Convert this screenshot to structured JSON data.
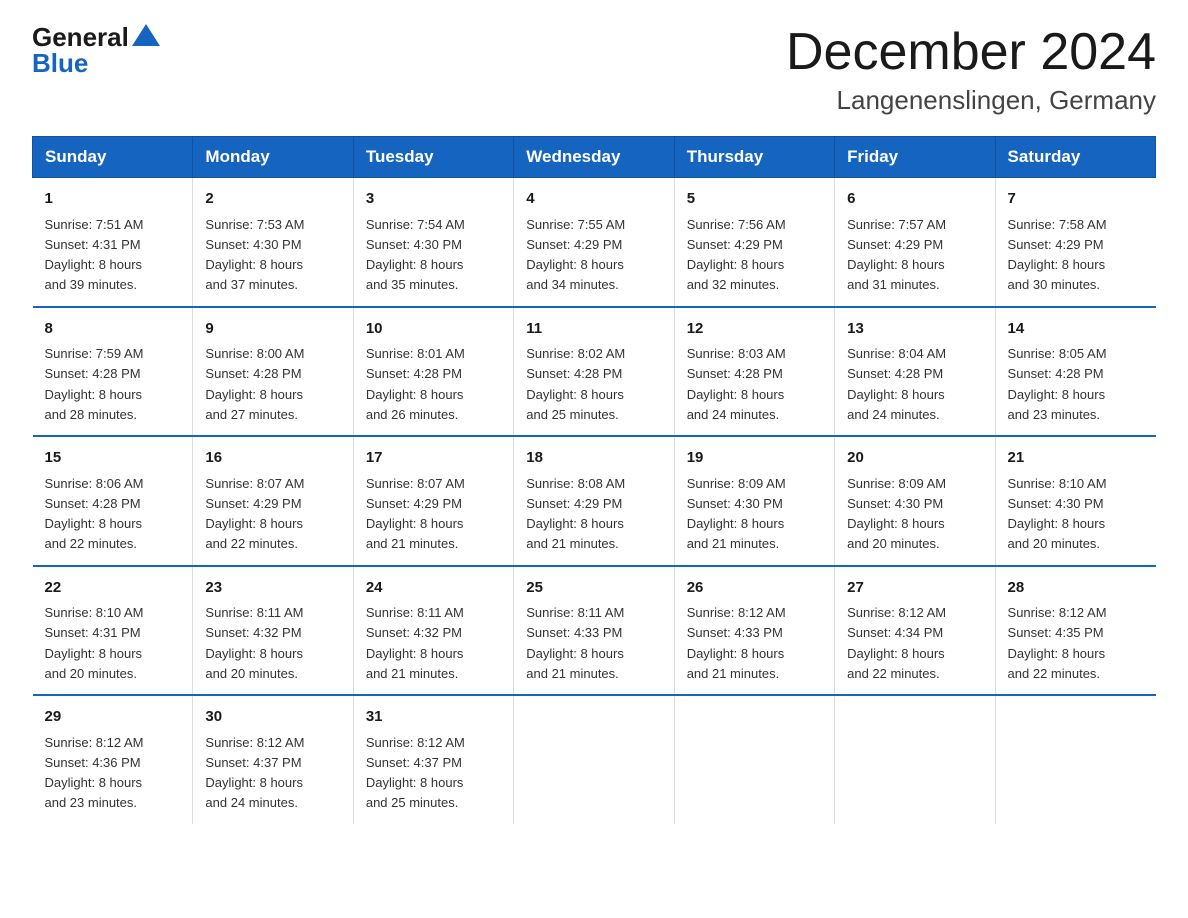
{
  "logo": {
    "text_general": "General",
    "triangle_char": "▲",
    "text_blue": "Blue"
  },
  "header": {
    "title": "December 2024",
    "subtitle": "Langenenslingen, Germany"
  },
  "days_of_week": [
    "Sunday",
    "Monday",
    "Tuesday",
    "Wednesday",
    "Thursday",
    "Friday",
    "Saturday"
  ],
  "weeks": [
    [
      {
        "day": "1",
        "sunrise": "7:51 AM",
        "sunset": "4:31 PM",
        "daylight": "8 hours and 39 minutes."
      },
      {
        "day": "2",
        "sunrise": "7:53 AM",
        "sunset": "4:30 PM",
        "daylight": "8 hours and 37 minutes."
      },
      {
        "day": "3",
        "sunrise": "7:54 AM",
        "sunset": "4:30 PM",
        "daylight": "8 hours and 35 minutes."
      },
      {
        "day": "4",
        "sunrise": "7:55 AM",
        "sunset": "4:29 PM",
        "daylight": "8 hours and 34 minutes."
      },
      {
        "day": "5",
        "sunrise": "7:56 AM",
        "sunset": "4:29 PM",
        "daylight": "8 hours and 32 minutes."
      },
      {
        "day": "6",
        "sunrise": "7:57 AM",
        "sunset": "4:29 PM",
        "daylight": "8 hours and 31 minutes."
      },
      {
        "day": "7",
        "sunrise": "7:58 AM",
        "sunset": "4:29 PM",
        "daylight": "8 hours and 30 minutes."
      }
    ],
    [
      {
        "day": "8",
        "sunrise": "7:59 AM",
        "sunset": "4:28 PM",
        "daylight": "8 hours and 28 minutes."
      },
      {
        "day": "9",
        "sunrise": "8:00 AM",
        "sunset": "4:28 PM",
        "daylight": "8 hours and 27 minutes."
      },
      {
        "day": "10",
        "sunrise": "8:01 AM",
        "sunset": "4:28 PM",
        "daylight": "8 hours and 26 minutes."
      },
      {
        "day": "11",
        "sunrise": "8:02 AM",
        "sunset": "4:28 PM",
        "daylight": "8 hours and 25 minutes."
      },
      {
        "day": "12",
        "sunrise": "8:03 AM",
        "sunset": "4:28 PM",
        "daylight": "8 hours and 24 minutes."
      },
      {
        "day": "13",
        "sunrise": "8:04 AM",
        "sunset": "4:28 PM",
        "daylight": "8 hours and 24 minutes."
      },
      {
        "day": "14",
        "sunrise": "8:05 AM",
        "sunset": "4:28 PM",
        "daylight": "8 hours and 23 minutes."
      }
    ],
    [
      {
        "day": "15",
        "sunrise": "8:06 AM",
        "sunset": "4:28 PM",
        "daylight": "8 hours and 22 minutes."
      },
      {
        "day": "16",
        "sunrise": "8:07 AM",
        "sunset": "4:29 PM",
        "daylight": "8 hours and 22 minutes."
      },
      {
        "day": "17",
        "sunrise": "8:07 AM",
        "sunset": "4:29 PM",
        "daylight": "8 hours and 21 minutes."
      },
      {
        "day": "18",
        "sunrise": "8:08 AM",
        "sunset": "4:29 PM",
        "daylight": "8 hours and 21 minutes."
      },
      {
        "day": "19",
        "sunrise": "8:09 AM",
        "sunset": "4:30 PM",
        "daylight": "8 hours and 21 minutes."
      },
      {
        "day": "20",
        "sunrise": "8:09 AM",
        "sunset": "4:30 PM",
        "daylight": "8 hours and 20 minutes."
      },
      {
        "day": "21",
        "sunrise": "8:10 AM",
        "sunset": "4:30 PM",
        "daylight": "8 hours and 20 minutes."
      }
    ],
    [
      {
        "day": "22",
        "sunrise": "8:10 AM",
        "sunset": "4:31 PM",
        "daylight": "8 hours and 20 minutes."
      },
      {
        "day": "23",
        "sunrise": "8:11 AM",
        "sunset": "4:32 PM",
        "daylight": "8 hours and 20 minutes."
      },
      {
        "day": "24",
        "sunrise": "8:11 AM",
        "sunset": "4:32 PM",
        "daylight": "8 hours and 21 minutes."
      },
      {
        "day": "25",
        "sunrise": "8:11 AM",
        "sunset": "4:33 PM",
        "daylight": "8 hours and 21 minutes."
      },
      {
        "day": "26",
        "sunrise": "8:12 AM",
        "sunset": "4:33 PM",
        "daylight": "8 hours and 21 minutes."
      },
      {
        "day": "27",
        "sunrise": "8:12 AM",
        "sunset": "4:34 PM",
        "daylight": "8 hours and 22 minutes."
      },
      {
        "day": "28",
        "sunrise": "8:12 AM",
        "sunset": "4:35 PM",
        "daylight": "8 hours and 22 minutes."
      }
    ],
    [
      {
        "day": "29",
        "sunrise": "8:12 AM",
        "sunset": "4:36 PM",
        "daylight": "8 hours and 23 minutes."
      },
      {
        "day": "30",
        "sunrise": "8:12 AM",
        "sunset": "4:37 PM",
        "daylight": "8 hours and 24 minutes."
      },
      {
        "day": "31",
        "sunrise": "8:12 AM",
        "sunset": "4:37 PM",
        "daylight": "8 hours and 25 minutes."
      },
      null,
      null,
      null,
      null
    ]
  ],
  "labels": {
    "sunrise": "Sunrise:",
    "sunset": "Sunset:",
    "daylight": "Daylight:"
  }
}
